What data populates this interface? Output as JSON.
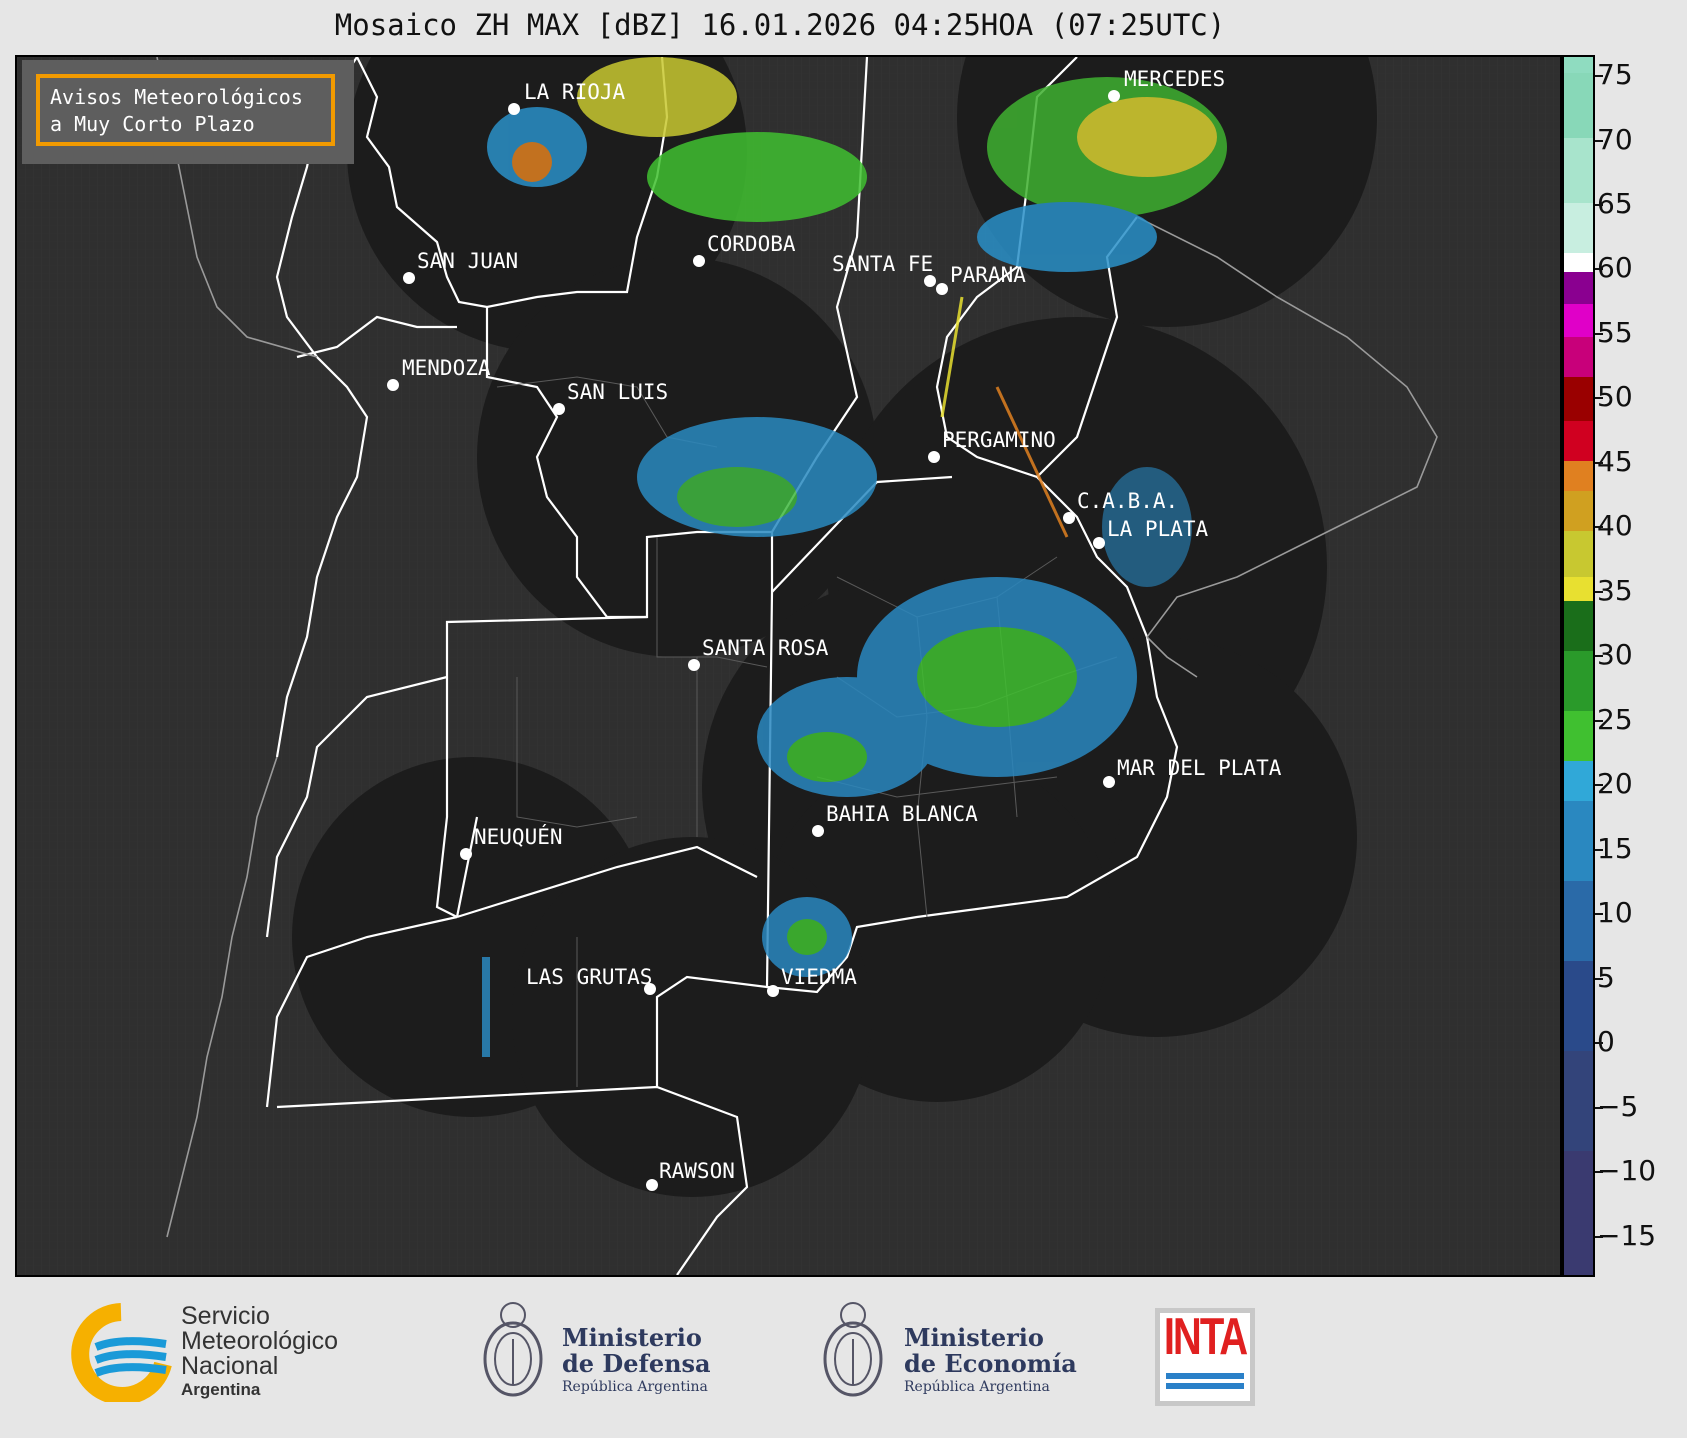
{
  "title": "Mosaico ZH MAX [dBZ] 16.01.2026 04:25HOA (07:25UTC)",
  "notice": {
    "line1": "Avisos Meteorológicos",
    "line2": "a Muy Corto Plazo"
  },
  "cities": [
    "LA RIOJA",
    "MERCEDES",
    "SAN JUAN",
    "CORDOBA",
    "SANTA FE",
    "PARANA",
    "MENDOZA",
    "SAN LUIS",
    "PERGAMINO",
    "C.A.B.A.",
    "LA PLATA",
    "SANTA ROSA",
    "MAR DEL PLATA",
    "BAHIA BLANCA",
    "NEUQUÉN",
    "LAS GRUTAS",
    "VIEDMA",
    "RAWSON"
  ],
  "colorbar": {
    "ticks": [
      "75",
      "70",
      "65",
      "60",
      "55",
      "50",
      "45",
      "40",
      "35",
      "30",
      "25",
      "20",
      "15",
      "10",
      "5",
      "0",
      "−5",
      "−10",
      "−15"
    ],
    "colors": {
      "cyan_high": "#8fdcc0",
      "white": "#ffffff",
      "magenta": "#e000c8",
      "red": "#d00020",
      "orange": "#e08020",
      "yellow": "#e8e030",
      "green": "#30c030",
      "light_blue": "#30a8d8",
      "dark_blue": "#2a4a8a"
    }
  },
  "logos": {
    "smn": {
      "line1": "Servicio",
      "line2": "Meteorológico",
      "line3": "Nacional",
      "line4": "Argentina"
    },
    "defensa": {
      "line1": "Ministerio",
      "line2": "de Defensa",
      "line3": "República Argentina"
    },
    "economia": {
      "line1": "Ministerio",
      "line2": "de Economía",
      "line3": "República Argentina"
    },
    "inta": {
      "text": "INTA"
    }
  }
}
